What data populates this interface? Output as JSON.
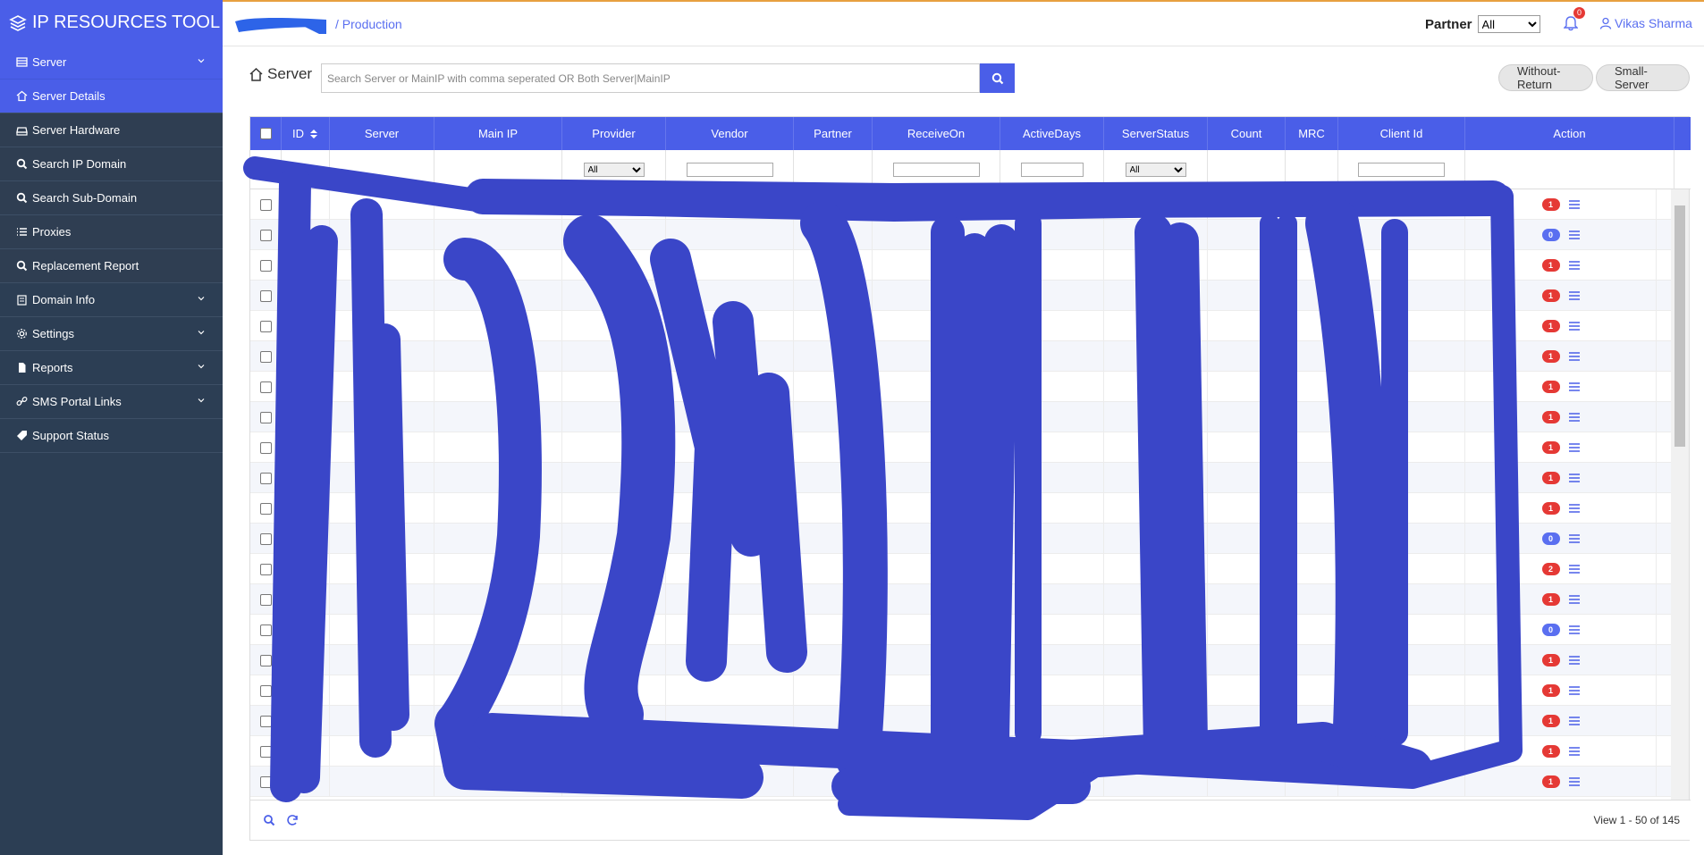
{
  "app": {
    "title": "IP RESOURCES TOOL",
    "breadcrumb": "/ Production",
    "accent_color": "#4a5ee8",
    "sidebar_color": "#2c3e54"
  },
  "sidebar": {
    "items": [
      {
        "label": "Server",
        "icon": "table-icon",
        "expandable": true,
        "state": "expanded"
      },
      {
        "label": "Server Details",
        "icon": "home-icon",
        "active": true
      },
      {
        "label": "Server Hardware",
        "icon": "hdd-icon"
      },
      {
        "label": "Search IP Domain",
        "icon": "search-icon"
      },
      {
        "label": "Search Sub-Domain",
        "icon": "search-icon"
      },
      {
        "label": "Proxies",
        "icon": "list-icon"
      },
      {
        "label": "Replacement Report",
        "icon": "search-icon"
      },
      {
        "label": "Domain Info",
        "icon": "clipboard-icon",
        "expandable": true
      },
      {
        "label": "Settings",
        "icon": "gear-icon",
        "expandable": true
      },
      {
        "label": "Reports",
        "icon": "file-icon",
        "expandable": true
      },
      {
        "label": "SMS Portal Links",
        "icon": "link-icon",
        "expandable": true
      },
      {
        "label": "Support Status",
        "icon": "tag-icon"
      }
    ]
  },
  "header": {
    "partner_label": "Partner",
    "partner_value": "All",
    "notification_count": "0",
    "user_name": "Vikas Sharma"
  },
  "search": {
    "title": "Server",
    "placeholder": "Search Server or MainIP with comma seperated OR Both Server|MainIP",
    "toggles": [
      "Without-Return",
      "Small-Server"
    ]
  },
  "table": {
    "columns": [
      "",
      "ID",
      "Server",
      "Main IP",
      "Provider",
      "Vendor",
      "Partner",
      "ReceiveOn",
      "ActiveDays",
      "ServerStatus",
      "Count",
      "MRC",
      "Client Id",
      "Action"
    ],
    "filter_select_value": "All",
    "row_badges": [
      "1",
      "0",
      "1",
      "1",
      "1",
      "1",
      "1",
      "1",
      "1",
      "1",
      "1",
      "0",
      "2",
      "1",
      "0",
      "1",
      "1",
      "1",
      "1",
      "1"
    ],
    "view_info": "View 1 - 50 of 145"
  }
}
